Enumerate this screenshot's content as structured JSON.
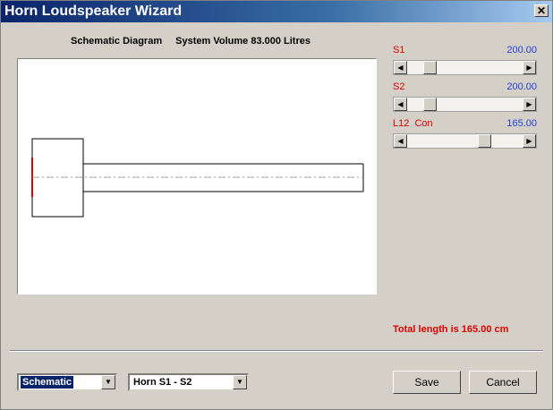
{
  "window": {
    "title": "Horn Loudspeaker Wizard",
    "close_glyph": "✕"
  },
  "diagram": {
    "heading": "Schematic Diagram",
    "system_volume": "System Volume 83.000 Litres"
  },
  "params": [
    {
      "label": "S1",
      "value": "200.00",
      "slider_fraction": 0.2
    },
    {
      "label": "S2",
      "value": "200.00",
      "slider_fraction": 0.2
    },
    {
      "label": "L12  Con",
      "value": "165.00",
      "slider_fraction": 0.6
    }
  ],
  "total_length": "Total length is 165.00 cm",
  "view_select": {
    "selected": "Schematic"
  },
  "section_select": {
    "selected": "Horn S1 - S2"
  },
  "buttons": {
    "save": "Save",
    "cancel": "Cancel"
  },
  "icons": {
    "close": "close-icon",
    "left_arrow": "arrow-left-icon",
    "right_arrow": "arrow-right-icon",
    "dropdown": "chevron-down-icon"
  },
  "colors": {
    "param_label": "#e00000",
    "param_value": "#2040e0",
    "total": "#e00000",
    "title_bar": "#0a246a",
    "driver_face": "#e00000"
  }
}
